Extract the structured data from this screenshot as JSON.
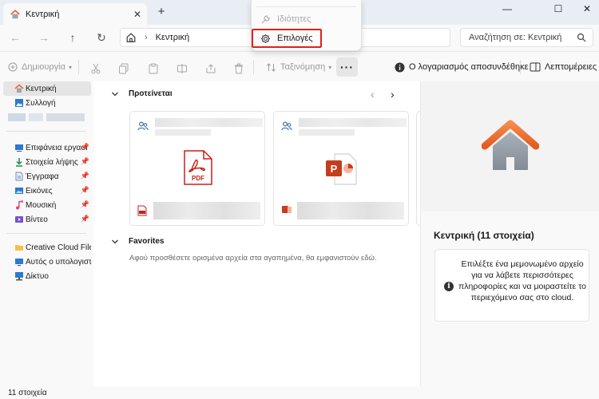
{
  "window": {
    "tab_title": "Κεντρική",
    "tab_close": "✕",
    "new_tab": "+",
    "controls": [
      "—",
      "☐",
      "✕"
    ]
  },
  "address_bar": {
    "back": "←",
    "forward": "→",
    "up": "↑",
    "refresh": "↻",
    "path_separator": "›",
    "path": "Κεντρική",
    "search_placeholder": "Αναζήτηση σε: Κεντρική"
  },
  "command_bar": {
    "new_label": "Δημιουργία",
    "sort_label": "Ταξινόμηση",
    "more_label": "···",
    "account_label": "Ο λογαριασμός αποσυνδέθηκε",
    "details_label": "Λεπτομέρειες"
  },
  "dropdown": {
    "properties_label": "Ιδιότητες",
    "options_label": "Επιλογές"
  },
  "sidebar": {
    "top_items": [
      {
        "label": "Κεντρική",
        "icon": "home-icon"
      },
      {
        "label": "Συλλογή",
        "icon": "gallery-icon"
      }
    ],
    "pinned_items": [
      {
        "label": "Επιφάνεια εργασί",
        "icon": "desktop-icon"
      },
      {
        "label": "Στοιχεία λήψης",
        "icon": "downloads-icon"
      },
      {
        "label": "Έγγραφα",
        "icon": "documents-icon"
      },
      {
        "label": "Εικόνες",
        "icon": "pictures-icon"
      },
      {
        "label": "Μουσική",
        "icon": "music-icon"
      },
      {
        "label": "Βίντεο",
        "icon": "videos-icon"
      }
    ],
    "pin_glyph": "📌",
    "bottom_items": [
      {
        "label": "Creative Cloud Files P",
        "icon": "cloud-folder-icon"
      },
      {
        "label": "Αυτός ο υπολογιστ",
        "icon": "computer-icon"
      },
      {
        "label": "Δίκτυο",
        "icon": "network-icon"
      }
    ]
  },
  "main": {
    "recommended_title": "Προτείνεται",
    "prev_arrow": "‹",
    "next_arrow": "›",
    "cards": [
      {
        "file_type": "PDF",
        "icon": "pdf-icon"
      },
      {
        "file_type": "P",
        "icon": "powerpoint-icon"
      }
    ],
    "favorites_title": "Favorites",
    "favorites_empty_text": "Αφού προσθέσετε ορισμένα αρχεία στα αγαπημένα, θα εμφανιστούν εδώ."
  },
  "details_pane": {
    "title": "Κεντρική (11 στοιχεία)",
    "info_glyph": "i",
    "info_text": "Επιλέξτε ένα μεμονωμένο αρχείο για να λάβετε περισσότερες πληροφορίες και να μοιραστείτε το περιεχόμενο σας στο cloud."
  },
  "status_bar": {
    "item_count": "11 στοιχεία"
  },
  "colors": {
    "accent_blue": "#0067c0",
    "highlight_red": "#d9241c",
    "pdf_red": "#c8201a",
    "ppt_orange": "#c43e1c",
    "home_orange": "#e96c33"
  }
}
